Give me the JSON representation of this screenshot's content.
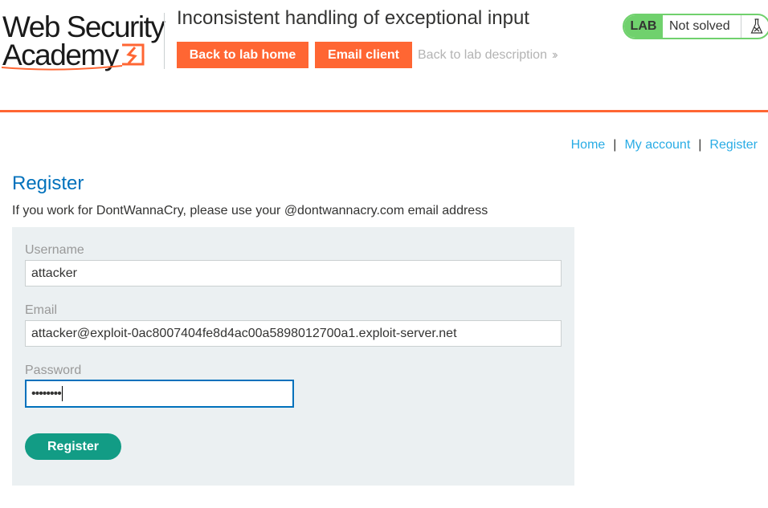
{
  "header": {
    "logo_line1": "Web Security",
    "logo_line2": "Academy",
    "lab_title": "Inconsistent handling of exceptional input",
    "back_to_lab_home": "Back to lab home",
    "email_client": "Email client",
    "back_to_description": "Back to lab description",
    "status": {
      "badge": "LAB",
      "text": "Not solved"
    }
  },
  "nav": {
    "items": [
      "Home",
      "My account",
      "Register"
    ],
    "separator": "|"
  },
  "page": {
    "title": "Register",
    "intro": "If you work for DontWannaCry, please use your @dontwannacry.com email address"
  },
  "form": {
    "username_label": "Username",
    "username_value": "attacker",
    "email_label": "Email",
    "email_value": "attacker@exploit-0ac8007404fe8d4ac00a5898012700a1.exploit-server.net",
    "password_label": "Password",
    "password_masked": "••••••••",
    "submit_label": "Register"
  },
  "colors": {
    "brand_orange": "#ff6633",
    "status_green": "#70d16d",
    "link_blue": "#29ace5",
    "heading_blue": "#0071bc",
    "submit_green": "#129c85",
    "panel_bg": "#ebf0f2"
  },
  "icons": {
    "logo_mark": "lightning-bracket-icon",
    "status_icon": "flask-icon",
    "back_chevron": "double-chevron-right-icon"
  }
}
